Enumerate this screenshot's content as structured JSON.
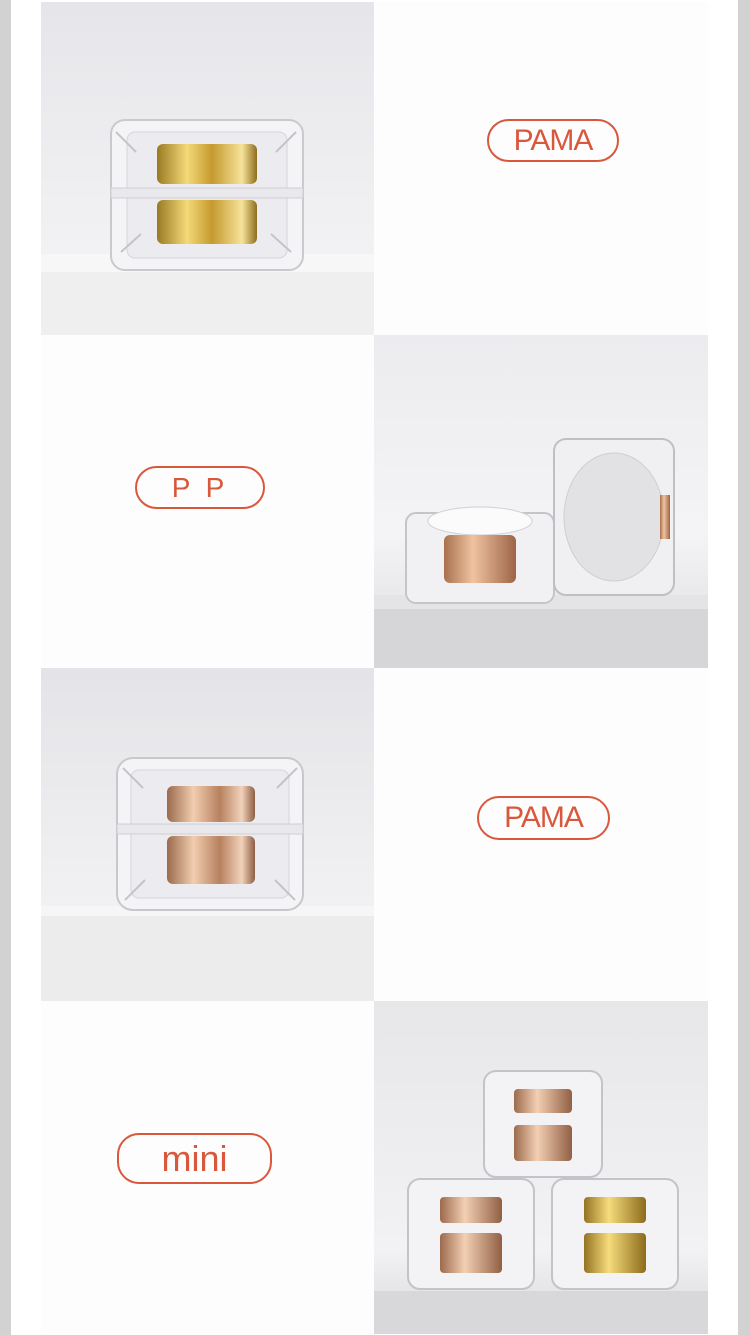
{
  "labels": {
    "pama_top": "PAMA",
    "pp": "P P",
    "pama_mid": "PAMA",
    "mini": "mini"
  },
  "photos": [
    {
      "name": "gold-jar-front",
      "description_icon": "jar-gold-icon"
    },
    {
      "name": "two-jars-open",
      "description_icon": "jar-rosegold-open-icon"
    },
    {
      "name": "rosegold-jar-front",
      "description_icon": "jar-rosegold-icon"
    },
    {
      "name": "three-jars-stack",
      "description_icon": "jar-stack-icon"
    }
  ],
  "colors": {
    "accent": "#d9583c",
    "gold": "#d4b04a",
    "rose_gold": "#d9a27e",
    "backdrop": "#e9e9ec",
    "surface": "#f3f3f3"
  }
}
